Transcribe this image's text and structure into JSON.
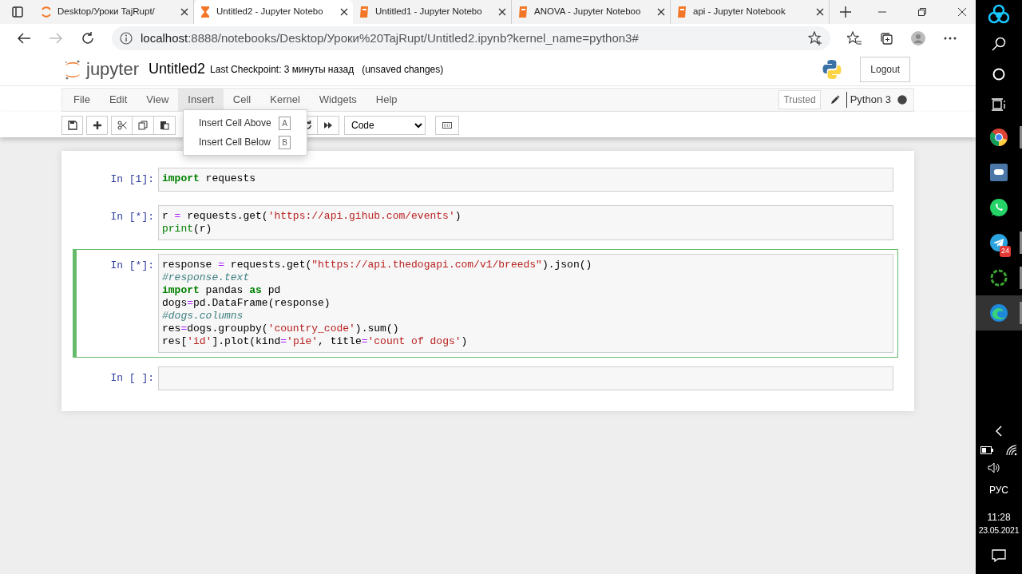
{
  "browser": {
    "tabs": [
      {
        "title": "Desktop/Уроки TajRupt/",
        "kind": "loading",
        "selected": false
      },
      {
        "title": "Untitled2 - Jupyter Notebo",
        "kind": "busy",
        "selected": true
      },
      {
        "title": "Untitled1 - Jupyter Notebo",
        "kind": "notebook",
        "selected": false
      },
      {
        "title": "ANOVA - Jupyter Noteboo",
        "kind": "notebook",
        "selected": false
      },
      {
        "title": "api - Jupyter Notebook",
        "kind": "notebook",
        "selected": false
      }
    ],
    "address": {
      "host": "localhost",
      "rest": ":8888/notebooks/Desktop/Уроки%20TajRupt/Untitled2.ipynb?kernel_name=python3#"
    }
  },
  "header": {
    "logo_text": "jupyter",
    "notebook_name": "Untitled2",
    "checkpoint": "Last Checkpoint: 3 минуты назад",
    "save_status": "(unsaved changes)",
    "logout": "Logout"
  },
  "menubar": {
    "items": [
      {
        "label": "File",
        "selected": false
      },
      {
        "label": "Edit",
        "selected": false
      },
      {
        "label": "View",
        "selected": false
      },
      {
        "label": "Insert",
        "selected": true
      },
      {
        "label": "Cell",
        "selected": false
      },
      {
        "label": "Kernel",
        "selected": false
      },
      {
        "label": "Widgets",
        "selected": false
      },
      {
        "label": "Help",
        "selected": false
      }
    ],
    "trusted": "Trusted",
    "kernel_name": "Python 3",
    "kernel_busy": true
  },
  "insert_menu": [
    {
      "label": "Insert Cell Above",
      "key": "A"
    },
    {
      "label": "Insert Cell Below",
      "key": "B"
    }
  ],
  "toolbar": {
    "cell_type": "Code"
  },
  "cells": [
    {
      "prompt": "In [1]:",
      "selected": false,
      "lines": [
        [
          {
            "t": "import",
            "kind": "keyword"
          },
          {
            "t": " requests",
            "kind": "plain"
          }
        ]
      ]
    },
    {
      "prompt": "In [*]:",
      "selected": false,
      "lines": [
        [
          {
            "t": "r ",
            "kind": "plain"
          },
          {
            "t": "=",
            "kind": "operator"
          },
          {
            "t": " requests.get(",
            "kind": "plain"
          },
          {
            "t": "'https://api.gihub.com/events'",
            "kind": "string"
          },
          {
            "t": ")",
            "kind": "plain"
          }
        ],
        [
          {
            "t": "print",
            "kind": "builtin"
          },
          {
            "t": "(r)",
            "kind": "plain"
          }
        ]
      ]
    },
    {
      "prompt": "In [*]:",
      "selected": true,
      "lines": [
        [
          {
            "t": "response ",
            "kind": "plain"
          },
          {
            "t": "=",
            "kind": "operator"
          },
          {
            "t": " requests.get(",
            "kind": "plain"
          },
          {
            "t": "\"https://api.thedogapi.com/v1/breeds\"",
            "kind": "string"
          },
          {
            "t": ").json()",
            "kind": "plain"
          }
        ],
        [
          {
            "t": "#response.text",
            "kind": "comment"
          }
        ],
        [
          {
            "t": "import",
            "kind": "keyword"
          },
          {
            "t": " pandas ",
            "kind": "plain"
          },
          {
            "t": "as",
            "kind": "keyword"
          },
          {
            "t": " pd",
            "kind": "plain"
          }
        ],
        [
          {
            "t": "dogs",
            "kind": "plain"
          },
          {
            "t": "=",
            "kind": "operator"
          },
          {
            "t": "pd.DataFrame(response)",
            "kind": "plain"
          }
        ],
        [
          {
            "t": "#dogs.columns",
            "kind": "comment"
          }
        ],
        [
          {
            "t": "res",
            "kind": "plain"
          },
          {
            "t": "=",
            "kind": "operator"
          },
          {
            "t": "dogs.groupby(",
            "kind": "plain"
          },
          {
            "t": "'country_code'",
            "kind": "string"
          },
          {
            "t": ").sum()",
            "kind": "plain"
          }
        ],
        [
          {
            "t": "res[",
            "kind": "plain"
          },
          {
            "t": "'id'",
            "kind": "string"
          },
          {
            "t": "].plot(kind",
            "kind": "plain"
          },
          {
            "t": "=",
            "kind": "operator"
          },
          {
            "t": "'pie'",
            "kind": "string"
          },
          {
            "t": ", title",
            "kind": "plain"
          },
          {
            "t": "=",
            "kind": "operator"
          },
          {
            "t": "'count of dogs'",
            "kind": "string"
          },
          {
            "t": ")",
            "kind": "plain"
          }
        ]
      ]
    },
    {
      "prompt": "In [ ]:",
      "selected": false
    }
  ],
  "taskbar": {
    "apps": [
      {
        "running": true,
        "selected": false
      },
      {
        "running": false,
        "selected": false
      },
      {
        "running": false,
        "selected": false
      },
      {
        "running": true,
        "selected": false,
        "badge": "24"
      },
      {
        "running": true,
        "selected": false
      },
      {
        "running": true,
        "selected": true
      }
    ],
    "language": "РУС",
    "time": "11:28",
    "date": "23.05.2021"
  }
}
